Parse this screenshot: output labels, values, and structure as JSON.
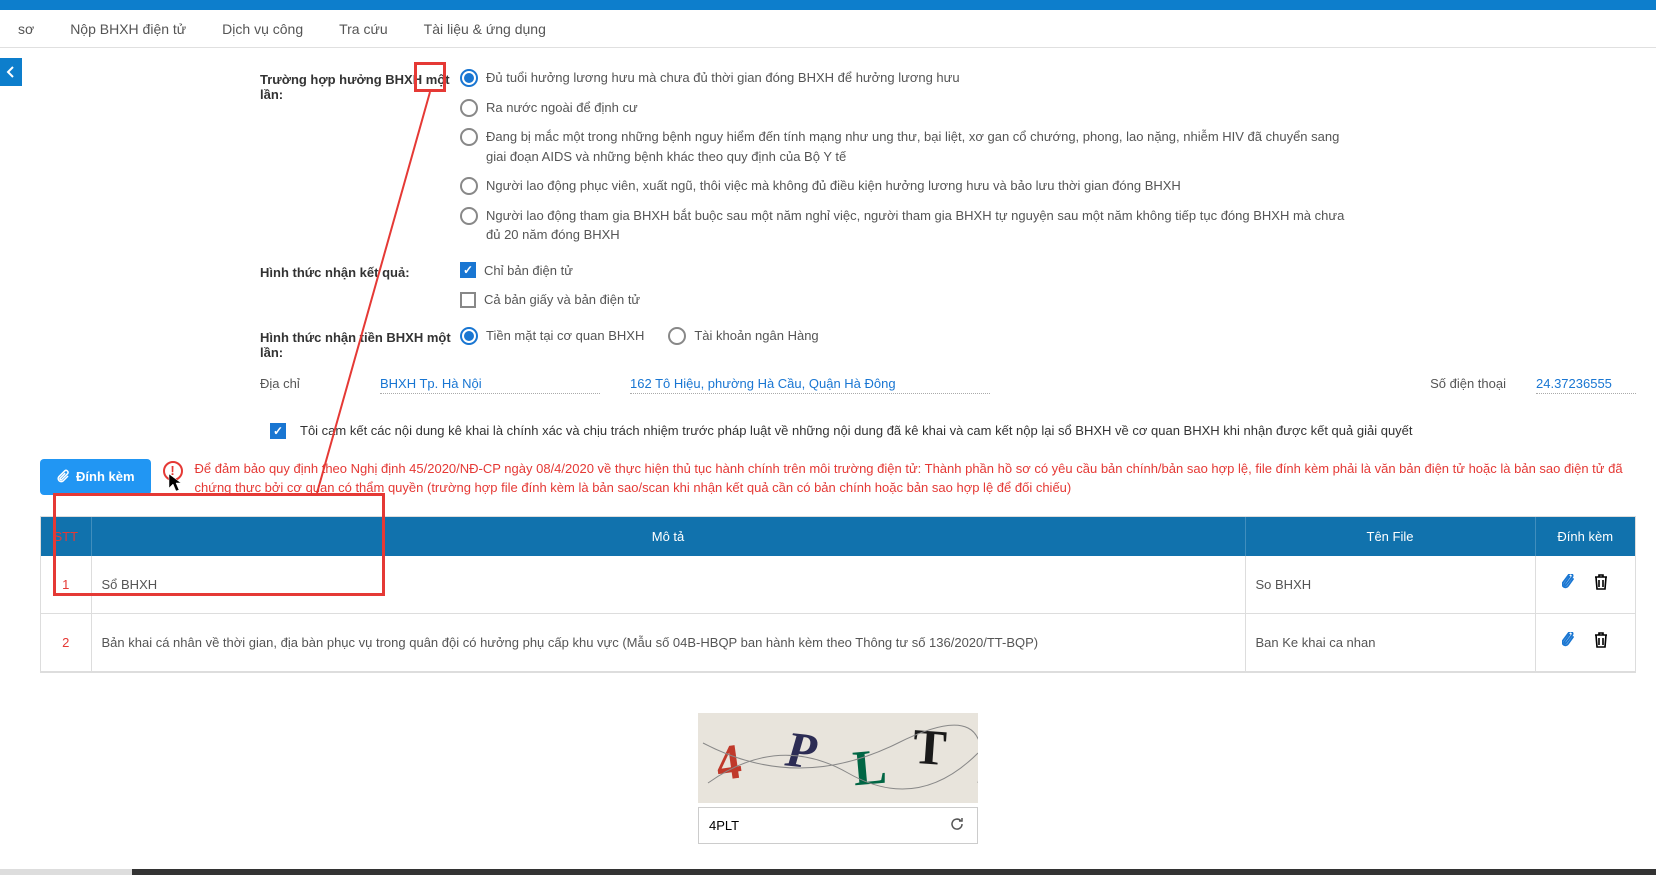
{
  "nav": {
    "items": [
      "sơ",
      "Nộp BHXH điện tử",
      "Dịch vụ công",
      "Tra cứu",
      "Tài liệu & ứng dụng"
    ]
  },
  "form": {
    "case_label": "Trường hợp hưởng BHXH một lần:",
    "case_options": [
      "Đủ tuổi hưởng lương hưu mà chưa đủ thời gian đóng BHXH để hưởng lương hưu",
      "Ra nước ngoài để định cư",
      "Đang bị mắc một trong những bệnh nguy hiểm đến tính mạng như ung thư, bại liệt, xơ gan cổ chướng, phong, lao nặng, nhiễm HIV đã chuyển sang giai đoạn AIDS và những bệnh khác theo quy định của Bộ Y tế",
      "Người lao động phục viên, xuất ngũ, thôi việc mà không đủ điều kiện hưởng lương hưu và bảo lưu thời gian đóng BHXH",
      "Người lao động tham gia BHXH bắt buộc sau một năm nghỉ việc, người tham gia BHXH tự nguyện sau một năm không tiếp tục đóng BHXH mà chưa đủ 20 năm đóng BHXH"
    ],
    "result_label": "Hình thức nhận kết quả:",
    "result_options": [
      "Chỉ bản điện tử",
      "Cả bản giấy và bản điện tử"
    ],
    "money_label": "Hình thức nhận tiền BHXH một lần:",
    "money_options": [
      "Tiền mặt tại cơ quan BHXH",
      "Tài khoản ngân Hàng"
    ],
    "addr_label": "Địa chỉ",
    "addr_org": "BHXH Tp. Hà Nội",
    "addr_detail": "162 Tô Hiệu, phường Hà Cầu, Quận Hà Đông",
    "phone_label": "Số điện thoại",
    "phone_value": "24.37236555",
    "commit": "Tôi cam kết các nội dung kê khai là chính xác và chịu trách nhiệm trước pháp luật về những nội dung đã kê khai và cam kết nộp lại sổ BHXH về cơ quan BHXH khi nhận được kết quả giải quyết"
  },
  "warning": {
    "attach_btn": "Đính kèm",
    "text": "Để đảm bảo quy định theo Nghị định 45/2020/NĐ-CP ngày 08/4/2020 về thực hiện thủ tục hành chính trên môi trường điện tử: Thành phần hồ sơ có yêu cầu bản chính/bản sao hợp lệ, file đính kèm phải là văn bản điện tử hoặc là bản sao điện tử đã chứng thực bởi cơ quan có thẩm quyền (trường hợp file đính kèm là bản sao/scan khi nhận kết quả cần có bản chính hoặc bản sao hợp lệ để đối chiếu)"
  },
  "table": {
    "headers": [
      "STT",
      "Mô tả",
      "Tên File",
      "Đính kèm"
    ],
    "rows": [
      {
        "stt": "1",
        "desc": "Sổ BHXH",
        "file": "So BHXH"
      },
      {
        "stt": "2",
        "desc": "Bản khai cá nhân về thời gian, địa bàn phục vụ trong quân đội có hưởng phụ cấp khu vực (Mẫu số 04B-HBQP ban hành kèm theo Thông tư số 136/2020/TT-BQP)",
        "file": "Ban Ke khai ca nhan"
      }
    ]
  },
  "captcha": {
    "chars": "4PLT",
    "input_value": "4PLT"
  }
}
